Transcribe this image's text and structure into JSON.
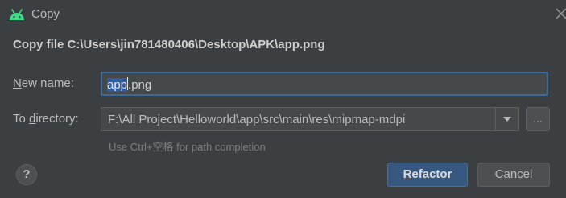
{
  "window": {
    "title": "Copy",
    "icon": "android-icon"
  },
  "heading": "Copy file C:\\Users\\jin781480406\\Desktop\\APK\\app.png",
  "form": {
    "new_name": {
      "label_mnemonic": "N",
      "label_rest": "ew name:",
      "value_selected": "app",
      "value_rest": ".png"
    },
    "to_directory": {
      "label_before": "To ",
      "label_mnemonic": "d",
      "label_after": "irectory:",
      "value": "F:\\All Project\\Helloworld\\app\\src\\main\\res\\mipmap-mdpi",
      "browse_label": "..."
    },
    "hint": "Use Ctrl+空格 for path completion"
  },
  "buttons": {
    "help": "?",
    "refactor_mnemonic": "R",
    "refactor_rest": "efactor",
    "cancel": "Cancel"
  },
  "colors": {
    "background": "#3c3f41",
    "accent": "#365880",
    "focus_border": "#3c6a99",
    "selection": "#2f5ca3"
  }
}
